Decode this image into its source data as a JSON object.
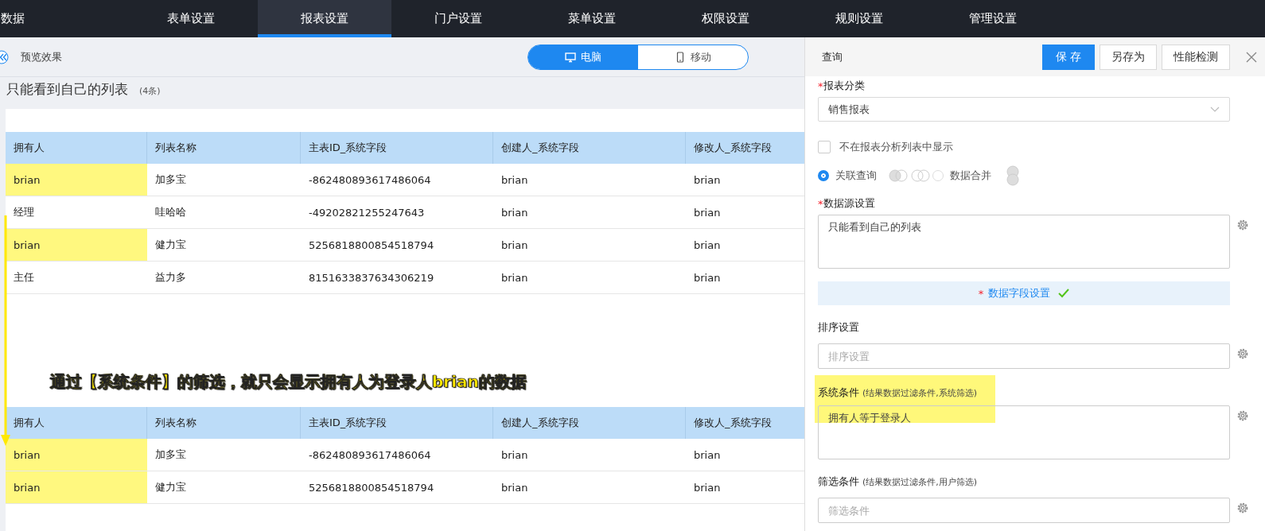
{
  "nav": {
    "tabs": [
      {
        "label": "数据",
        "selected": false
      },
      {
        "label": "表单设置",
        "selected": false
      },
      {
        "label": "报表设置",
        "selected": true
      },
      {
        "label": "门户设置",
        "selected": false
      },
      {
        "label": "菜单设置",
        "selected": false
      },
      {
        "label": "权限设置",
        "selected": false
      },
      {
        "label": "规则设置",
        "selected": false
      },
      {
        "label": "管理设置",
        "selected": false
      }
    ]
  },
  "preview": {
    "title": "预览效果",
    "devices": [
      {
        "label": "电脑",
        "kind": "desktop",
        "selected": true
      },
      {
        "label": "移动",
        "kind": "mobile",
        "selected": false
      }
    ]
  },
  "list": {
    "title": "只能看到自己的列表",
    "count": "(4条)"
  },
  "table_before": {
    "columns": [
      "拥有人",
      "列表名称",
      "主表ID_系统字段",
      "创建人_系统字段",
      "修改人_系统字段"
    ],
    "rows": [
      {
        "highlighted": true,
        "cells": [
          "brian",
          "加多宝",
          "-862480893617486064",
          "brian",
          "brian"
        ]
      },
      {
        "highlighted": false,
        "cells": [
          "经理",
          "哇哈哈",
          "-49202821255247643",
          "brian",
          "brian"
        ]
      },
      {
        "highlighted": true,
        "cells": [
          "brian",
          "健力宝",
          "5256818800854518794",
          "brian",
          "brian"
        ]
      },
      {
        "highlighted": false,
        "cells": [
          "主任",
          "益力多",
          "8151633837634306219",
          "brian",
          "brian"
        ]
      }
    ]
  },
  "annotation": {
    "text": "通过【系统条件】的筛选，就只会显示拥有人为登录人brian的数据",
    "arrow": true
  },
  "table_after": {
    "columns": [
      "拥有人",
      "列表名称",
      "主表ID_系统字段",
      "创建人_系统字段",
      "修改人_系统字段"
    ],
    "rows": [
      {
        "highlighted": true,
        "cells": [
          "brian",
          "加多宝",
          "-862480893617486064",
          "brian",
          "brian"
        ]
      },
      {
        "highlighted": true,
        "cells": [
          "brian",
          "健力宝",
          "5256818800854518794",
          "brian",
          "brian"
        ]
      }
    ]
  },
  "panel": {
    "title": "查询",
    "buttons": [
      {
        "label": "保 存",
        "kind": "primary"
      },
      {
        "label": "另存为",
        "kind": "default"
      },
      {
        "label": "性能检测",
        "kind": "default"
      }
    ],
    "form": {
      "category": {
        "label": "报表分类",
        "required": true,
        "required_mark": "*",
        "value": "销售报表"
      },
      "hide_option": {
        "label": "不在报表分析列表中显示",
        "checked": false
      },
      "query_modes": [
        {
          "label": "关联查询",
          "selected": true
        },
        {
          "label": "数据合并",
          "selected": false
        }
      ],
      "datasource": {
        "label": "数据源设置",
        "required": true,
        "required_mark": "*",
        "value": "只能看到自己的列表"
      },
      "field_settings": {
        "label": "数据字段设置",
        "required": true,
        "required_mark": "*",
        "done": true
      },
      "sort": {
        "label": "排序设置",
        "placeholder": "排序设置"
      },
      "system_condition": {
        "label": "系统条件",
        "hint": "(结果数据过滤条件,系统筛选)",
        "value": "拥有人等于登录人",
        "highlighted": true
      },
      "filter": {
        "label": "筛选条件",
        "hint": "(结果数据过滤条件,用户筛选)",
        "placeholder": "筛选条件"
      }
    }
  }
}
